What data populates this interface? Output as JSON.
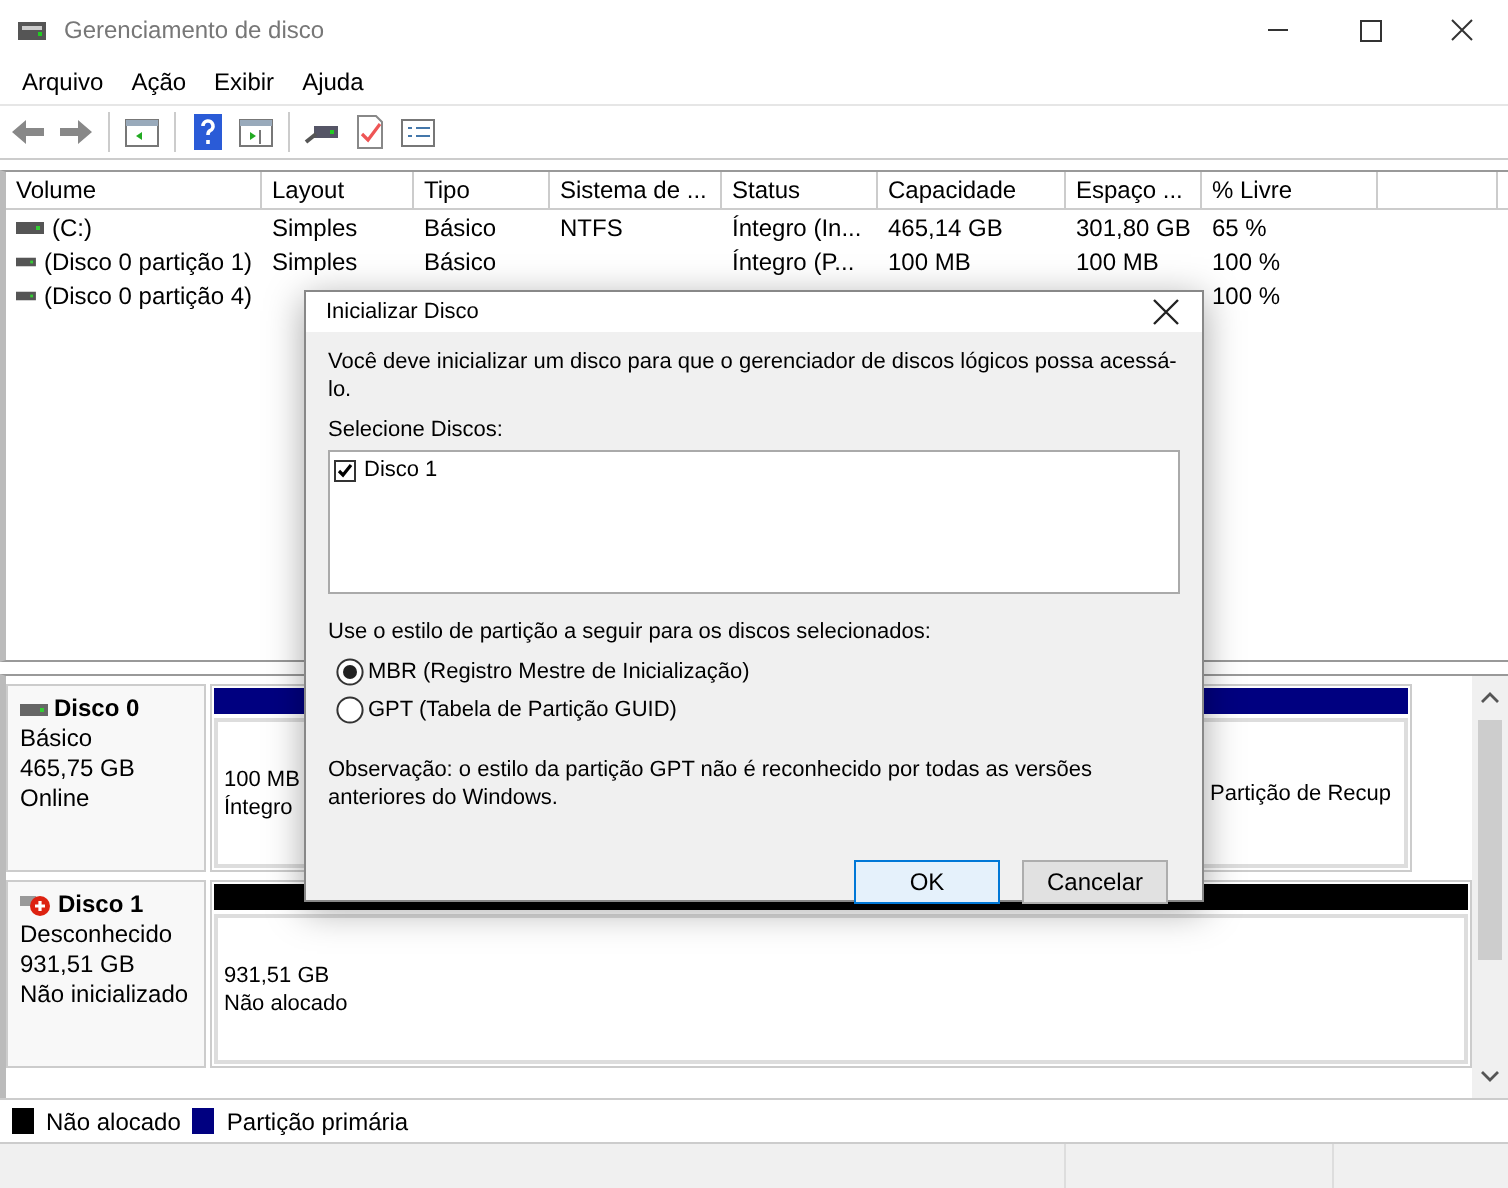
{
  "window": {
    "title": "Gerenciamento de disco"
  },
  "menu": [
    "Arquivo",
    "Ação",
    "Exibir",
    "Ajuda"
  ],
  "volume_list": {
    "columns": [
      "Volume",
      "Layout",
      "Tipo",
      "Sistema de ...",
      "Status",
      "Capacidade",
      "Espaço ...",
      "% Livre"
    ],
    "rows": [
      {
        "volume": "(C:)",
        "layout": "Simples",
        "tipo": "Básico",
        "sistema": "NTFS",
        "status": "Íntegro (In...",
        "capacidade": "465,14 GB",
        "espaco": "301,80 GB",
        "livre": "65 %"
      },
      {
        "volume": "(Disco 0 partição 1)",
        "layout": "Simples",
        "tipo": "Básico",
        "status": "Íntegro (P...",
        "capacidade": "100 MB",
        "espaco": "100 MB",
        "livre": "100 %"
      },
      {
        "volume": "(Disco 0 partição 4)",
        "livre": "100 %"
      }
    ]
  },
  "disks": [
    {
      "name": "Disco 0",
      "kind": "online",
      "type": "Básico",
      "size": "465,75 GB",
      "state": "Online",
      "partitions": [
        {
          "kind": "primary",
          "size": "100 MB",
          "status": "Íntegro"
        },
        {
          "kind": "primary",
          "status": "Partição de Recup"
        }
      ]
    },
    {
      "name": "Disco 1",
      "kind": "error",
      "type": "Desconhecido",
      "size": "931,51 GB",
      "state": "Não inicializado",
      "partitions": [
        {
          "kind": "unallocated",
          "size": "931,51 GB",
          "status": "Não alocado"
        }
      ]
    }
  ],
  "legend": [
    {
      "label": "Não alocado",
      "color": "#000000"
    },
    {
      "label": "Partição primária",
      "color": "#000080"
    }
  ],
  "dialog": {
    "title": "Inicializar Disco",
    "message": "Você deve inicializar um disco para que o gerenciador de discos lógicos possa acessá-lo.",
    "disks_label": "Selecione Discos:",
    "disks": [
      {
        "label": "Disco 1",
        "checked": true
      }
    ],
    "style_label": "Use o estilo de partição a seguir para os discos selecionados:",
    "styles": [
      {
        "label": "MBR (Registro Mestre de Inicialização)",
        "selected": true
      },
      {
        "label": "GPT (Tabela de Partição GUID)",
        "selected": false
      }
    ],
    "note": "Observação: o estilo da partição GPT não é reconhecido por todas as versões anteriores do Windows.",
    "buttons": [
      {
        "label": "OK",
        "default": true
      },
      {
        "label": "Cancelar",
        "default": false
      }
    ]
  }
}
